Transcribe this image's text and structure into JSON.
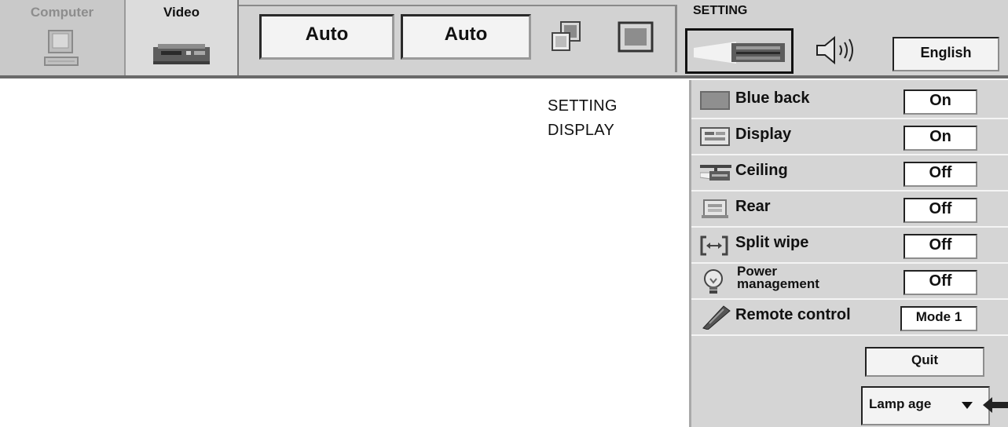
{
  "top_bar": {
    "tabs": [
      {
        "label": "Computer",
        "icon": "computer-icon",
        "active": false
      },
      {
        "label": "Video",
        "icon": "vcr-icon",
        "active": true
      }
    ],
    "video_toolbar": {
      "system_value": "Auto",
      "mode_value": "Auto",
      "icons": [
        "image-adjust-icon",
        "screen-icon"
      ]
    },
    "setting_section": {
      "label": "SETTING",
      "icons": [
        "projector-icon",
        "speaker-icon"
      ],
      "language": "English"
    }
  },
  "annotation": {
    "line1": "SETTING",
    "line2": "DISPLAY"
  },
  "setting_menu": {
    "items": [
      {
        "label": "Blue back",
        "value": "On",
        "icon": "blue-back-icon"
      },
      {
        "label": "Display",
        "value": "On",
        "icon": "display-icon"
      },
      {
        "label": "Ceiling",
        "value": "Off",
        "icon": "ceiling-icon"
      },
      {
        "label": "Rear",
        "value": "Off",
        "icon": "rear-icon"
      },
      {
        "label": "Split wipe",
        "value": "Off",
        "icon": "split-wipe-icon"
      },
      {
        "label_line1": "Power",
        "label_line2": "management",
        "value": "Off",
        "icon": "lightbulb-icon"
      },
      {
        "label": "Remote control",
        "value": "Mode 1",
        "icon": "remote-control-icon"
      }
    ],
    "quit_label": "Quit",
    "lamp_age_label": "Lamp age"
  }
}
